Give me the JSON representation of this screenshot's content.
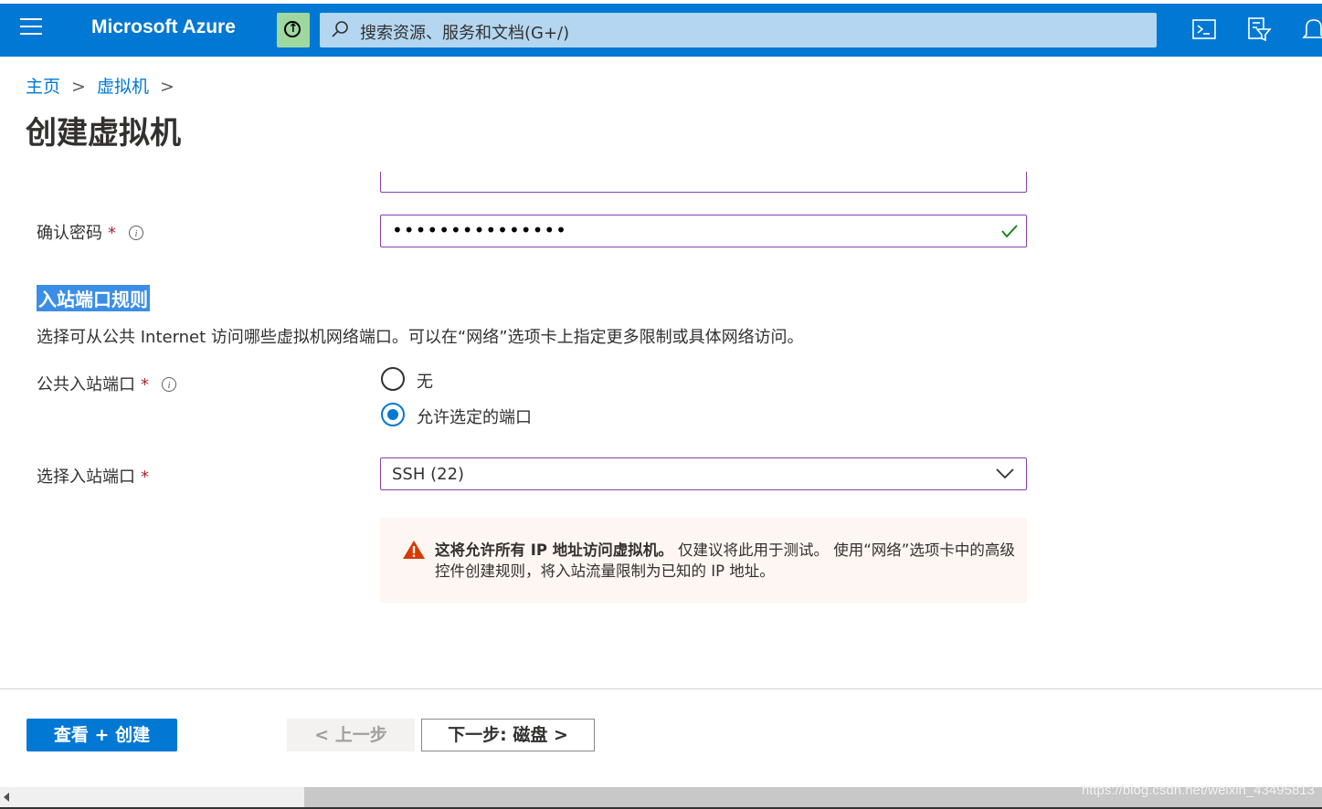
{
  "topbar": {
    "brand": "Microsoft Azure",
    "search_placeholder": "搜索资源、服务和文档(G+/)",
    "icons": [
      "hamburger-menu-icon",
      "upgrade-icon",
      "search-icon",
      "cloud-shell-icon",
      "directory-filter-icon",
      "notifications-icon"
    ],
    "colors": {
      "bar": "#0078d4",
      "search": "#b4d6f0",
      "upgrade": "#9fd89f"
    }
  },
  "breadcrumb": {
    "items": [
      "主页",
      "虚拟机"
    ],
    "separator": ">"
  },
  "page_title": "创建虚拟机",
  "form": {
    "confirm_password": {
      "label": "确认密码",
      "required": "*",
      "value": "•••••••••••••••",
      "valid": true
    },
    "inbound_section": {
      "heading": "入站端口规则",
      "description": "选择可从公共 Internet 访问哪些虚拟机网络端口。可以在“网络”选项卡上指定更多限制或具体网络访问。"
    },
    "public_inbound_ports": {
      "label": "公共入站端口",
      "required": "*",
      "options": [
        {
          "label": "无",
          "selected": false
        },
        {
          "label": "允许选定的端口",
          "selected": true
        }
      ]
    },
    "select_inbound_ports": {
      "label": "选择入站端口",
      "required": "*",
      "value": "SSH (22)"
    },
    "warning": {
      "bold": "这将允许所有 IP 地址访问虚拟机。",
      "text": " 仅建议将此用于测试。 使用“网络”选项卡中的高级控件创建规则，将入站流量限制为已知的 IP 地址。",
      "icon": "warning-icon"
    }
  },
  "footer": {
    "review_create": "查看 + 创建",
    "previous": "< 上一步",
    "next": "下一步: 磁盘 >"
  },
  "watermark": "https://blog.csdn.net/weixin_43495813"
}
